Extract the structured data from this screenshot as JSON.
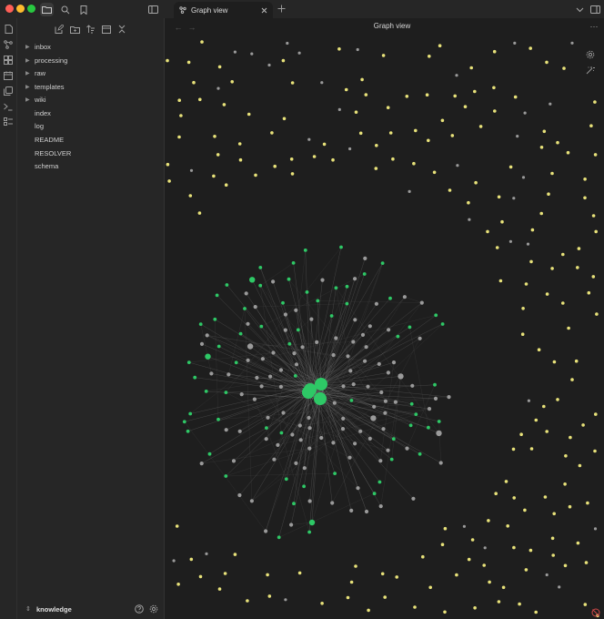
{
  "window": {
    "traffic_lights": [
      "close",
      "minimize",
      "maximize"
    ]
  },
  "titlebar": {
    "left_icons": [
      "folder-icon",
      "search-icon",
      "bookmark-icon",
      "sidebar-toggle-icon"
    ],
    "right_icons": [
      "chevron-down-icon",
      "right-sidebar-toggle-icon"
    ]
  },
  "tab": {
    "label": "Graph view",
    "icon": "graph-icon"
  },
  "header": {
    "title": "Graph view",
    "more": "···"
  },
  "ribbon": {
    "icons": [
      "file-icon",
      "graph-icon",
      "canvas-icon",
      "calendar-icon",
      "copy-icon",
      "terminal-icon",
      "command-palette-icon"
    ]
  },
  "sidebar": {
    "toolbar_icons": [
      "new-note-icon",
      "new-folder-icon",
      "sort-icon",
      "collapse-panel-icon",
      "collapse-all-icon"
    ],
    "folders": [
      {
        "label": "inbox"
      },
      {
        "label": "processing"
      },
      {
        "label": "raw"
      },
      {
        "label": "templates"
      },
      {
        "label": "wiki"
      }
    ],
    "files": [
      {
        "label": "index"
      },
      {
        "label": "log"
      },
      {
        "label": "README"
      },
      {
        "label": "RESOLVER"
      },
      {
        "label": "schema"
      }
    ]
  },
  "vault": {
    "name": "knowledge",
    "icons": [
      "help-icon",
      "settings-icon"
    ]
  },
  "graph": {
    "colors": {
      "yellow": "#e8e27a",
      "grey": "#9a9a9a",
      "green": "#2ec866",
      "edge": "#8a8a8a"
    },
    "controls": [
      "graph-settings-icon",
      "animate-icon"
    ]
  }
}
